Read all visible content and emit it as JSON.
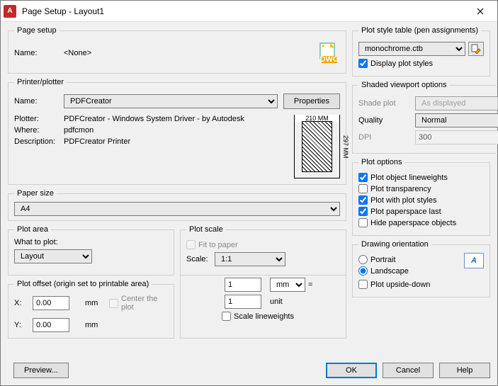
{
  "window": {
    "title": "Page Setup - Layout1"
  },
  "pageSetup": {
    "legend": "Page setup",
    "nameLabel": "Name:",
    "nameValue": "<None>"
  },
  "printer": {
    "legend": "Printer/plotter",
    "nameLabel": "Name:",
    "nameValue": "PDFCreator",
    "propertiesBtn": "Properties",
    "plotterLabel": "Plotter:",
    "plotterValue": "PDFCreator - Windows System Driver - by Autodesk",
    "whereLabel": "Where:",
    "whereValue": "pdfcmon",
    "descLabel": "Description:",
    "descValue": "PDFCreator Printer",
    "previewWidth": "210 MM",
    "previewHeight": "297 MM"
  },
  "paperSize": {
    "legend": "Paper size",
    "value": "A4"
  },
  "plotArea": {
    "legend": "Plot area",
    "whatLabel": "What to plot:",
    "value": "Layout"
  },
  "plotScale": {
    "legend": "Plot scale",
    "fitLabel": "Fit to paper",
    "scaleLabel": "Scale:",
    "scaleValue": "1:1",
    "num": "1",
    "unit": "mm",
    "eq": "=",
    "den": "1",
    "unitWord": "unit",
    "scaleLwLabel": "Scale lineweights"
  },
  "plotOffset": {
    "legend": "Plot offset (origin set to printable area)",
    "xLabel": "X:",
    "xVal": "0.00",
    "xUnit": "mm",
    "yLabel": "Y:",
    "yVal": "0.00",
    "yUnit": "mm",
    "centerLabel": "Center the plot"
  },
  "plotStyle": {
    "legend": "Plot style table (pen assignments)",
    "value": "monochrome.ctb",
    "displayLabel": "Display plot styles"
  },
  "shaded": {
    "legend": "Shaded viewport options",
    "shadeLabel": "Shade plot",
    "shadeValue": "As displayed",
    "qualityLabel": "Quality",
    "qualityValue": "Normal",
    "dpiLabel": "DPI",
    "dpiValue": "300"
  },
  "plotOptions": {
    "legend": "Plot options",
    "lw": "Plot object lineweights",
    "trans": "Plot transparency",
    "styles": "Plot with plot styles",
    "pspace": "Plot paperspace last",
    "hide": "Hide paperspace objects"
  },
  "orientation": {
    "legend": "Drawing orientation",
    "portrait": "Portrait",
    "landscape": "Landscape",
    "upside": "Plot upside-down",
    "iconLetter": "A"
  },
  "footer": {
    "preview": "Preview...",
    "ok": "OK",
    "cancel": "Cancel",
    "help": "Help"
  }
}
